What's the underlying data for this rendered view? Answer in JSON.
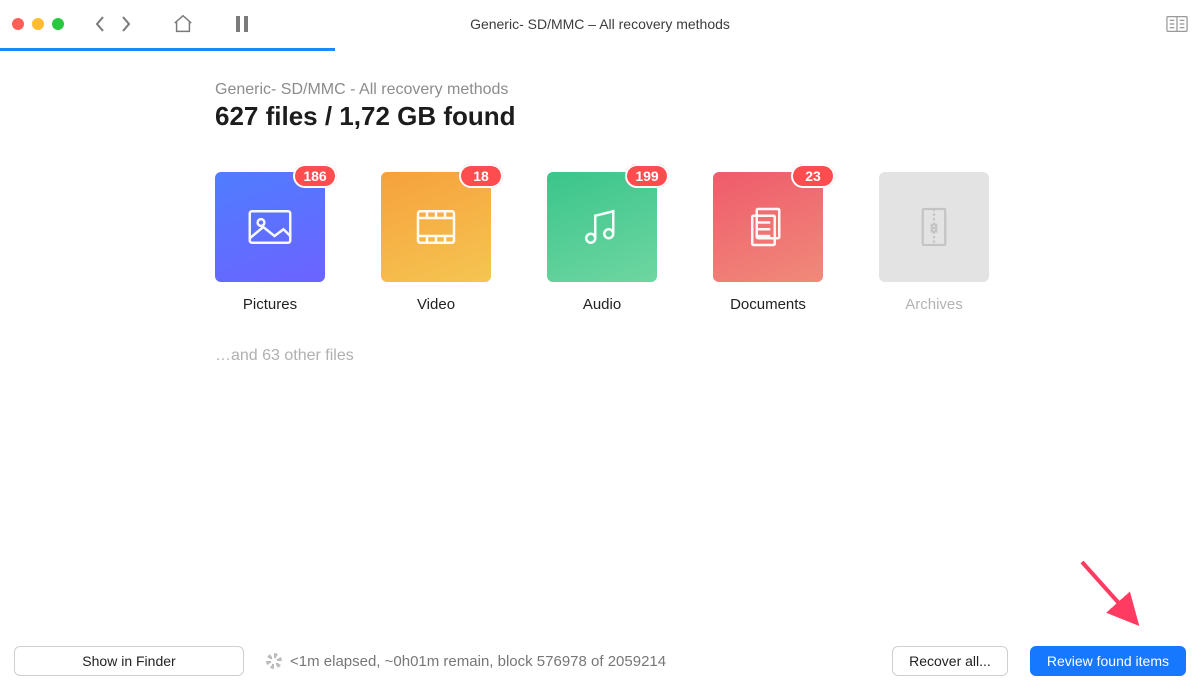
{
  "window": {
    "title": "Generic- SD/MMC – All recovery methods"
  },
  "main": {
    "subtitle": "Generic- SD/MMC - All recovery methods",
    "headline": "627 files / 1,72 GB found",
    "other_files": "…and 63 other files"
  },
  "categories": [
    {
      "id": "pictures",
      "label": "Pictures",
      "count": "186"
    },
    {
      "id": "video",
      "label": "Video",
      "count": "18"
    },
    {
      "id": "audio",
      "label": "Audio",
      "count": "199"
    },
    {
      "id": "documents",
      "label": "Documents",
      "count": "23"
    },
    {
      "id": "archives",
      "label": "Archives",
      "count": ""
    }
  ],
  "footer": {
    "show_in_finder": "Show in Finder",
    "status_text": "<1m elapsed, ~0h01m remain, block 576978 of 2059214",
    "recover_all": "Recover all...",
    "review": "Review found items"
  }
}
